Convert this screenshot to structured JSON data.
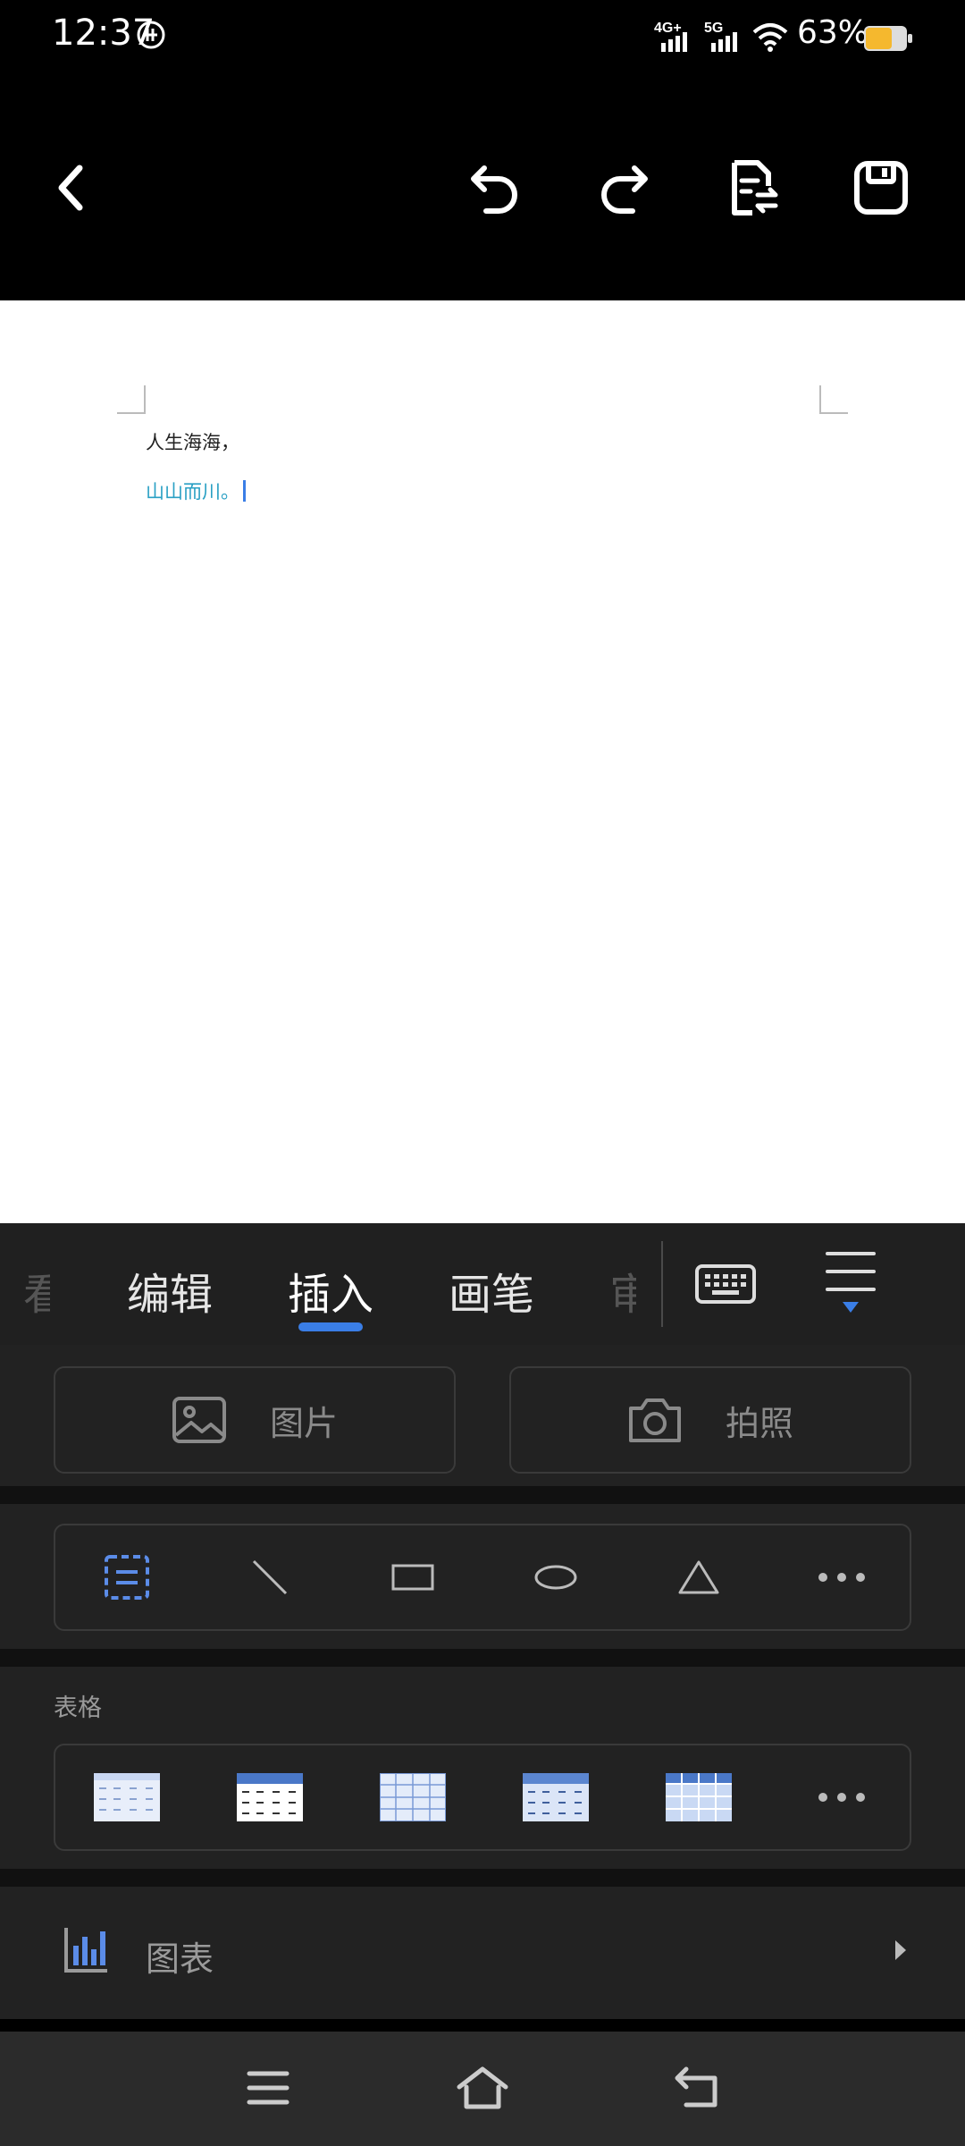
{
  "status_bar": {
    "time": "12:37",
    "network_1": "4G+",
    "network_2": "5G",
    "battery_percent": "63%",
    "battery_color": "#f5b82e"
  },
  "toolbar": {
    "back_icon": "chevron-left-icon",
    "undo_icon": "undo-icon",
    "redo_icon": "redo-icon",
    "convert_icon": "document-convert-icon",
    "save_icon": "save-icon"
  },
  "document": {
    "line1": "人生海海，",
    "line2": "山山而川。",
    "line2_color": "#2aa0c4"
  },
  "tabs": {
    "partial_left": "看",
    "items": [
      "编辑",
      "插入",
      "画笔"
    ],
    "active": "插入",
    "partial_right": "审",
    "accent": "#3a7ee6"
  },
  "insert": {
    "picture_label": "图片",
    "camera_label": "拍照"
  },
  "shapes": {
    "items": [
      "textbox-icon",
      "line-icon",
      "rectangle-icon",
      "ellipse-icon",
      "triangle-icon",
      "more-icon"
    ]
  },
  "table": {
    "title": "表格",
    "styles": [
      "table-style-1",
      "table-style-2",
      "table-style-3",
      "table-style-4",
      "table-style-5",
      "more-icon"
    ]
  },
  "chart": {
    "label": "图表"
  }
}
